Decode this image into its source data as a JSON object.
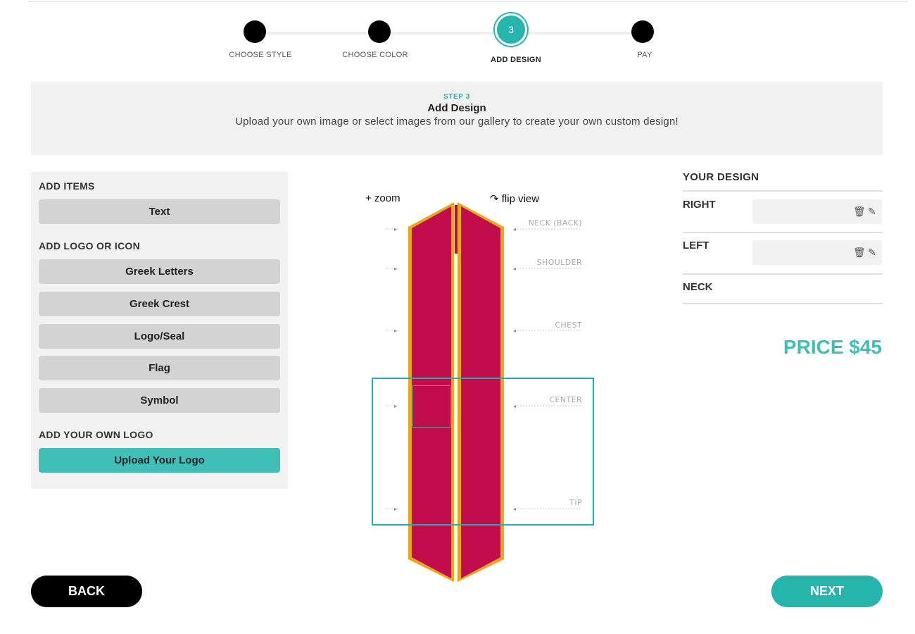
{
  "stepper": {
    "steps": [
      {
        "label": "CHOOSE STYLE"
      },
      {
        "label": "CHOOSE COLOR"
      },
      {
        "label": "ADD DESIGN",
        "number": "3"
      },
      {
        "label": "PAY"
      }
    ],
    "active_index": 2
  },
  "banner": {
    "eyebrow": "STEP 3",
    "title": "Add Design",
    "description": "Upload your own image or select images from our gallery to create your own custom design!"
  },
  "add_items": {
    "title": "ADD ITEMS",
    "buttons": [
      "Text"
    ]
  },
  "add_logo": {
    "title": "ADD LOGO OR ICON",
    "buttons": [
      "Greek Letters",
      "Greek Crest",
      "Logo/Seal",
      "Flag",
      "Symbol"
    ]
  },
  "own_logo": {
    "title": "ADD YOUR OWN LOGO",
    "button": "Upload Your Logo"
  },
  "preview": {
    "zoom_label": "+ zoom",
    "flip_label": "flip view",
    "flip_icon": "rotate-cw-icon",
    "regions": [
      "NECK (BACK)",
      "SHOULDER",
      "CHEST",
      "CENTER",
      "TIP"
    ],
    "stole_color": "#c20d4d",
    "trim_color": "#e8a81c",
    "selection_color": "#1fadb6"
  },
  "your_design": {
    "title": "YOUR DESIGN",
    "rows": [
      {
        "label": "RIGHT"
      },
      {
        "label": "LEFT"
      },
      {
        "label": "NECK"
      }
    ],
    "delete_icon": "trash-icon",
    "edit_icon": "pencil-icon"
  },
  "price": "PRICE $45",
  "nav": {
    "back": "BACK",
    "next": "NEXT"
  },
  "colors": {
    "accent": "#26b5ad",
    "accent_light": "#3fbfb7"
  }
}
